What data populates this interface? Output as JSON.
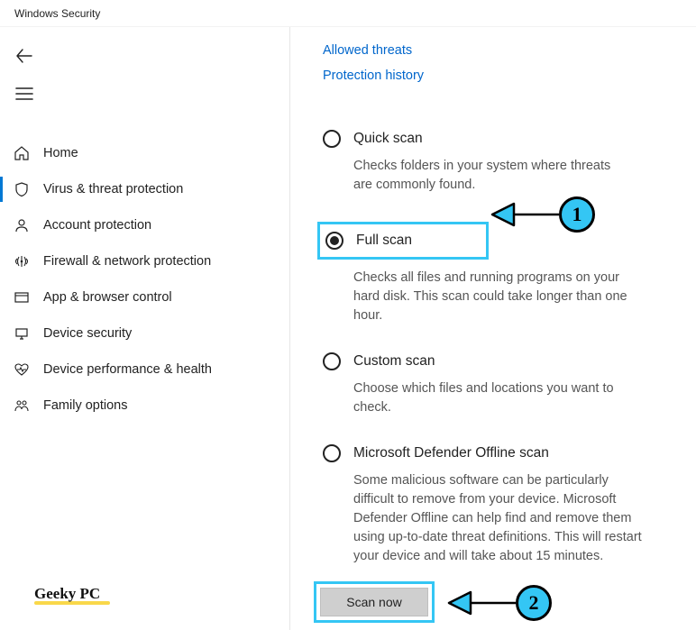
{
  "window": {
    "title": "Windows Security"
  },
  "sidebar": {
    "items": [
      {
        "label": "Home"
      },
      {
        "label": "Virus & threat protection"
      },
      {
        "label": "Account protection"
      },
      {
        "label": "Firewall & network protection"
      },
      {
        "label": "App & browser control"
      },
      {
        "label": "Device security"
      },
      {
        "label": "Device performance & health"
      },
      {
        "label": "Family options"
      }
    ]
  },
  "watermark": "Geeky PC",
  "links": {
    "allowed": "Allowed threats",
    "history": "Protection history"
  },
  "scan_options": {
    "quick": {
      "label": "Quick scan",
      "desc": "Checks folders in your system where threats are commonly found."
    },
    "full": {
      "label": "Full scan",
      "desc": "Checks all files and running programs on your hard disk. This scan could take longer than one hour."
    },
    "custom": {
      "label": "Custom scan",
      "desc": "Choose which files and locations you want to check."
    },
    "offline": {
      "label": "Microsoft Defender Offline scan",
      "desc": "Some malicious software can be particularly difficult to remove from your device. Microsoft Defender Offline can help find and remove them using up-to-date threat definitions. This will restart your device and will take about 15 minutes."
    }
  },
  "scan_button": "Scan now",
  "annotations": {
    "step1": "1",
    "step2": "2"
  }
}
